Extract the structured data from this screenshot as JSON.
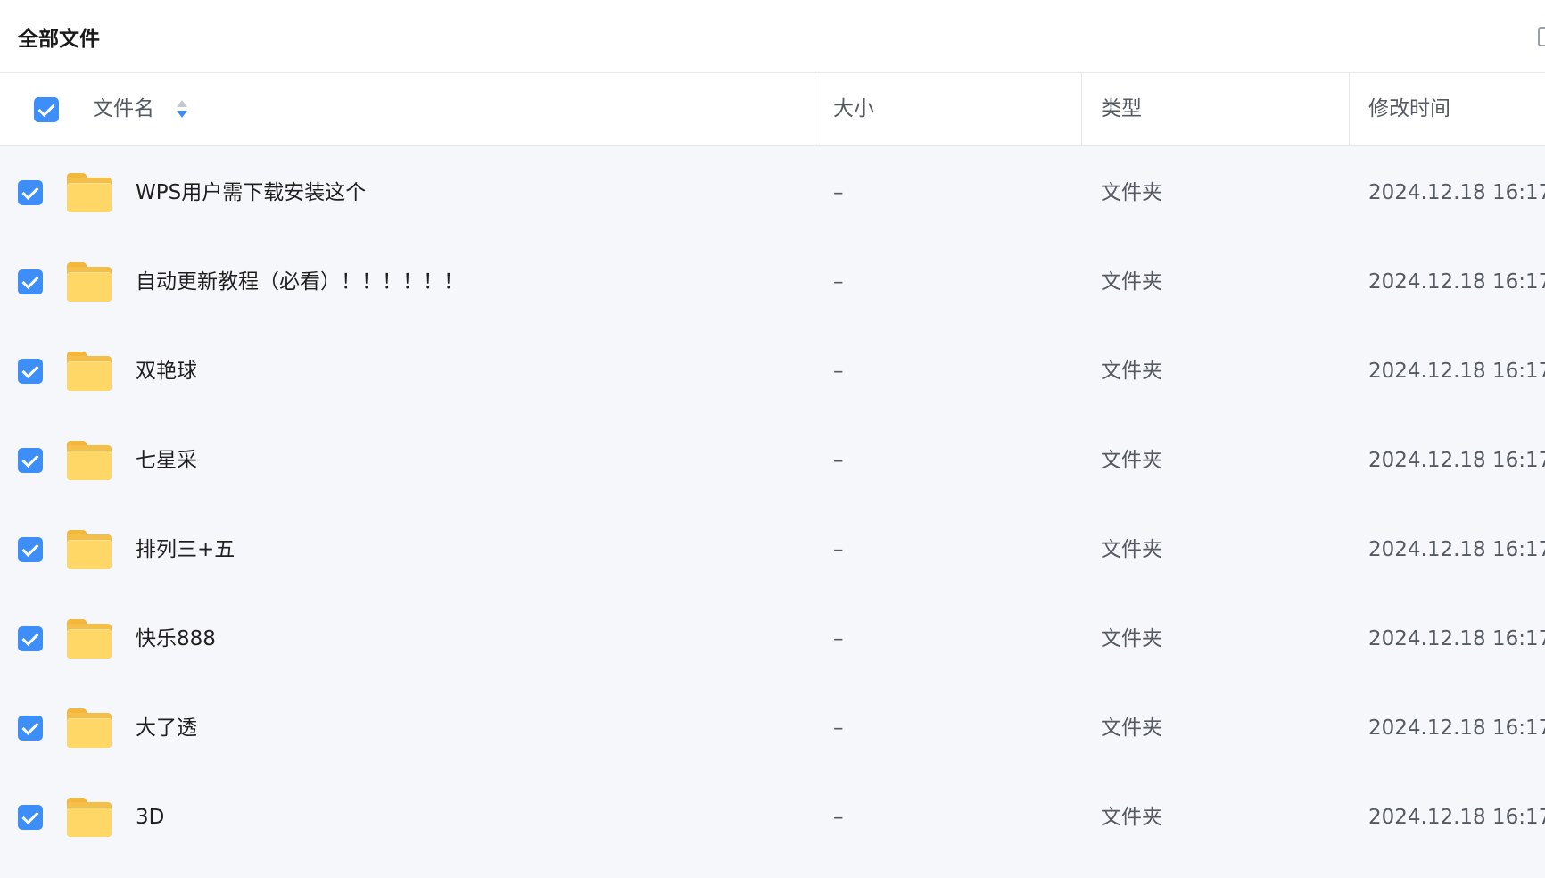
{
  "breadcrumb": {
    "title": "全部文件"
  },
  "table": {
    "headers": {
      "name": "文件名",
      "size": "大小",
      "type": "类型",
      "modified": "修改时间"
    },
    "sort": {
      "column": "name",
      "direction": "descending"
    },
    "select_all_checked": true,
    "rows": [
      {
        "name": "WPS用户需下载安装这个",
        "size": "–",
        "type": "文件夹",
        "modified": "2024.12.18 16:17",
        "checked": true,
        "icon": "folder-icon"
      },
      {
        "name": "自动更新教程（必看）！！！！！！",
        "size": "–",
        "type": "文件夹",
        "modified": "2024.12.18 16:17",
        "checked": true,
        "icon": "folder-icon"
      },
      {
        "name": "双艳球",
        "size": "–",
        "type": "文件夹",
        "modified": "2024.12.18 16:17",
        "checked": true,
        "icon": "folder-icon"
      },
      {
        "name": "七星采",
        "size": "–",
        "type": "文件夹",
        "modified": "2024.12.18 16:17",
        "checked": true,
        "icon": "folder-icon"
      },
      {
        "name": "排列三+五",
        "size": "–",
        "type": "文件夹",
        "modified": "2024.12.18 16:17",
        "checked": true,
        "icon": "folder-icon"
      },
      {
        "name": "快乐888",
        "size": "–",
        "type": "文件夹",
        "modified": "2024.12.18 16:17",
        "checked": true,
        "icon": "folder-icon"
      },
      {
        "name": "大了透",
        "size": "–",
        "type": "文件夹",
        "modified": "2024.12.18 16:17",
        "checked": true,
        "icon": "folder-icon"
      },
      {
        "name": "3D",
        "size": "–",
        "type": "文件夹",
        "modified": "2024.12.18 16:17",
        "checked": true,
        "icon": "folder-icon"
      }
    ]
  },
  "colors": {
    "accent": "#3d8ef8",
    "folder": "#ffd766",
    "row_background": "#f6f7fb",
    "header_background": "#ffffff"
  }
}
